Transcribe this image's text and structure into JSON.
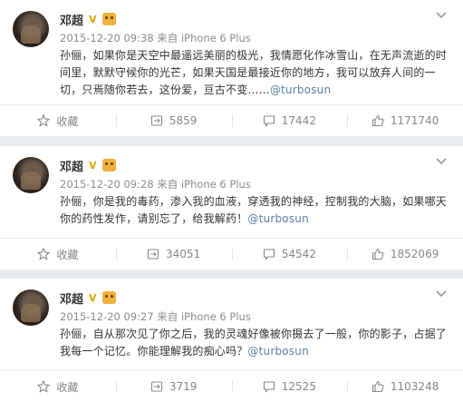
{
  "posts": [
    {
      "name": "邓超",
      "verified_mark": "V",
      "time": "2015-12-20 09:38",
      "source": "来自 iPhone 6 Plus",
      "text": "孙俪，如果你是天空中最遥远美丽的极光，我情愿化作冰雪山，在无声流逝的时间里，默默守候你的光芒，如果天国是最接近你的地方，我可以放弃人间的一切，只焉随你若去，这份爱，亘古不变……",
      "mention": "@turbosun",
      "favorite_label": "收藏",
      "reposts": "5859",
      "comments": "17442",
      "likes": "1171740"
    },
    {
      "name": "邓超",
      "verified_mark": "V",
      "time": "2015-12-20 09:28",
      "source": "来自 iPhone 6 Plus",
      "text": "孙俪，你是我的毒药，渗入我的血液，穿透我的神经，控制我的大脑，如果哪天你的药性发作，请别忘了，给我解药！",
      "mention": "@turbosun",
      "favorite_label": "收藏",
      "reposts": "34051",
      "comments": "54542",
      "likes": "1852069"
    },
    {
      "name": "邓超",
      "verified_mark": "V",
      "time": "2015-12-20 09:27",
      "source": "来自 iPhone 6 Plus",
      "text": "孙俪，自从那次见了你之后，我的灵魂好像被你摄去了一般，你的影子，占据了我每一个记忆。你能理解我的痴心吗？",
      "mention": "@turbosun",
      "favorite_label": "收藏",
      "reposts": "3719",
      "comments": "12525",
      "likes": "1103248"
    }
  ],
  "colors": {
    "background": "#e7eaef",
    "card": "#ffffff",
    "mention": "#5b7fa6",
    "meta": "#8c8c8c",
    "vip": "#e8a300"
  },
  "icons": [
    "chevron-down-icon",
    "star-icon",
    "repost-icon",
    "comment-icon",
    "like-icon"
  ]
}
